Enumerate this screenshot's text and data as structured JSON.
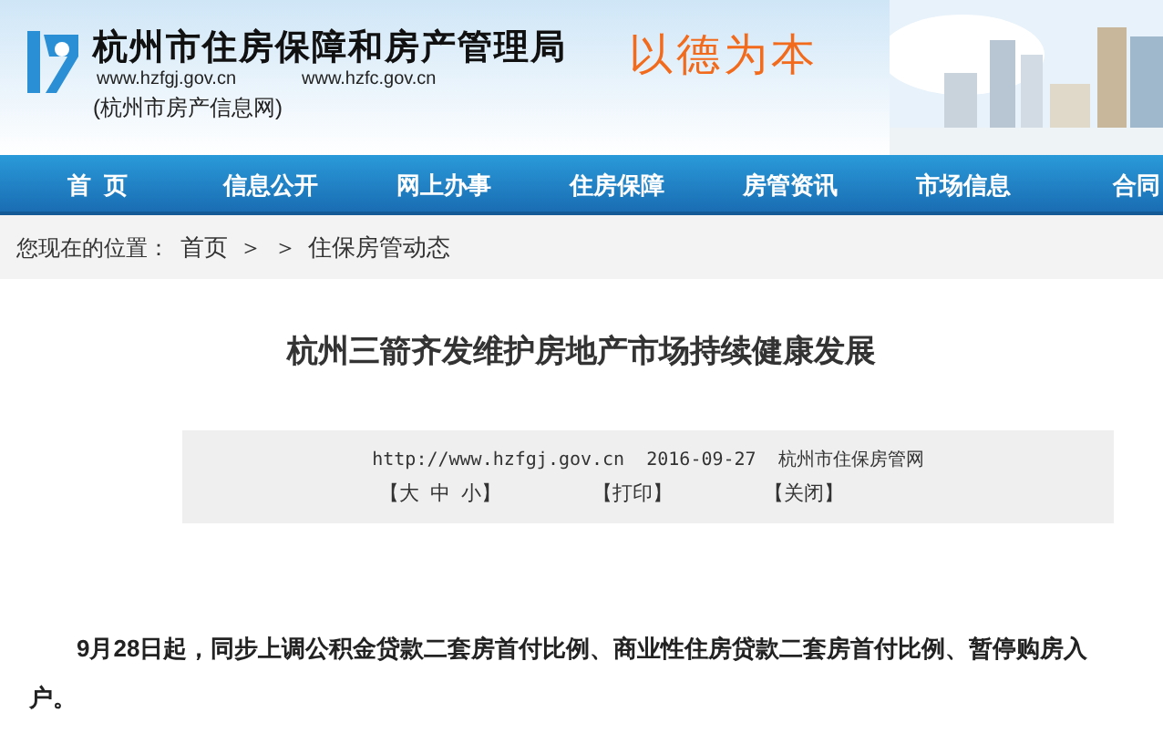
{
  "header": {
    "title": "杭州市住房保障和房产管理局",
    "urls": [
      "www.hzfgj.gov.cn",
      "www.hzfc.gov.cn"
    ],
    "subtitle": "(杭州市房产信息网)",
    "slogan": "以德为本"
  },
  "nav": [
    {
      "label": "首  页"
    },
    {
      "label": "信息公开"
    },
    {
      "label": "网上办事"
    },
    {
      "label": "住房保障"
    },
    {
      "label": "房管资讯"
    },
    {
      "label": "市场信息"
    },
    {
      "label": "合同"
    }
  ],
  "breadcrumb": {
    "prefix": "您现在的位置：",
    "items": [
      "首页",
      "＞",
      "＞",
      "住保房管动态"
    ]
  },
  "article": {
    "title": "杭州三箭齐发维护房地产市场持续健康发展",
    "meta": "http://www.hzfgj.gov.cn  2016-09-27  杭州市住保房管网",
    "tools": [
      "【大  中  小】",
      "【打印】",
      "【关闭】"
    ],
    "body": "9月28日起，同步上调公积金贷款二套房首付比例、商业性住房贷款二套房首付比例、暂停购房入户。"
  }
}
